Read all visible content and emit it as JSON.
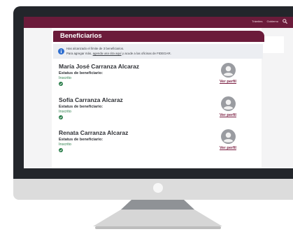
{
  "topnav": {
    "tramites": "Trámites",
    "gobierno": "Gobierno"
  },
  "section": {
    "title": "Beneficiarios"
  },
  "notice": {
    "line1": "Has alcanzado el límite de 3 beneficiarios.",
    "line2_prefix": "Para agregar más, ",
    "line2_link": "agenda una cita aquí",
    "line2_suffix": " y acude a las oficinas de FIDEGAR."
  },
  "beneficiaries": [
    {
      "name": "María José Carranza Alcaraz",
      "status_label": "Estatus de beneficiario:",
      "status_value": "Inscrito",
      "profile_link": "Ver perfil"
    },
    {
      "name": "Sofía Carranza Alcaraz",
      "status_label": "Estatus de beneficiario:",
      "status_value": "Inscrito",
      "profile_link": "Ver perfil"
    },
    {
      "name": "Renata Carranza Alcaraz",
      "status_label": "Estatus de beneficiario:",
      "status_value": "Inscrito",
      "profile_link": "Ver perfil"
    }
  ],
  "colors": {
    "brand": "#6b1b3a",
    "status_ok": "#2a7d4a",
    "info": "#2f6fd0"
  },
  "icons": {
    "search": "search-icon",
    "info": "info-icon",
    "check": "check-circle-icon",
    "avatar": "user-avatar-icon"
  }
}
